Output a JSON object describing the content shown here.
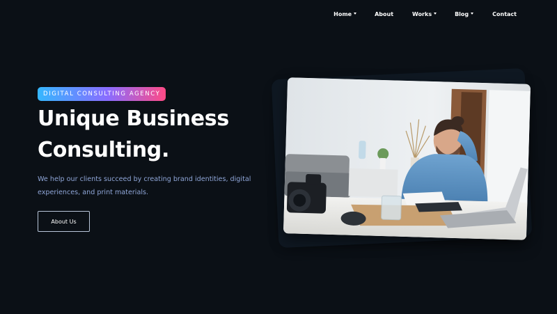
{
  "nav": {
    "items": [
      {
        "label": "Home",
        "has_dropdown": true
      },
      {
        "label": "About",
        "has_dropdown": false
      },
      {
        "label": "Works",
        "has_dropdown": true
      },
      {
        "label": "Blog",
        "has_dropdown": true
      },
      {
        "label": "Contact",
        "has_dropdown": false
      }
    ]
  },
  "hero": {
    "badge": "DIGITAL CONSULTING AGENCY",
    "headline_line1": "Unique Business",
    "headline_line2": "Consulting.",
    "subtext": "We help our clients succeed by creating brand identities, digital experiences, and print materials.",
    "cta_label": "About Us"
  },
  "colors": {
    "background": "#0b1016",
    "badge_gradient": [
      "#35b7ff",
      "#8a6cff",
      "#ff4b86"
    ],
    "subtext": "#8fa6d8",
    "frame_gradient": [
      "#36c4ff",
      "#b45bff",
      "#ff4f88"
    ]
  },
  "hero_image": {
    "icon": "consultant-photo"
  }
}
